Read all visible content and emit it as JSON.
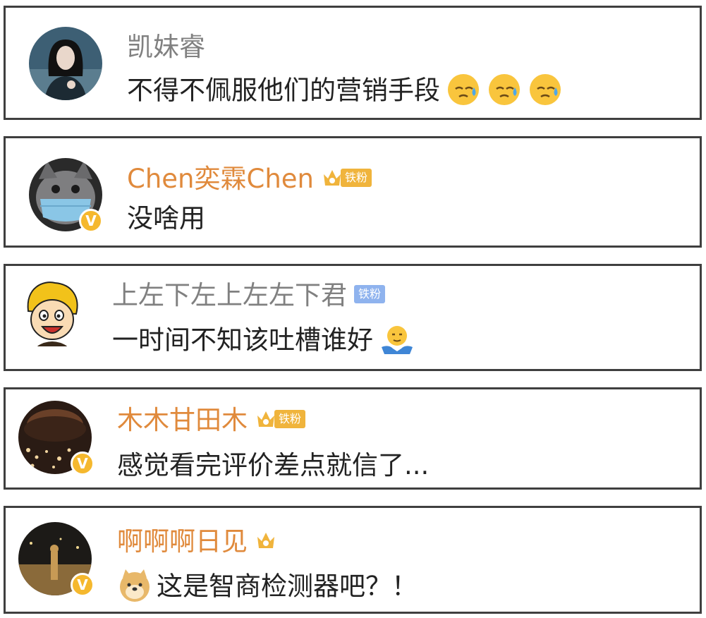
{
  "comments": [
    {
      "user": "凯妹睿",
      "text": "不得不佩服他们的营销手段",
      "name_color": "#808080",
      "verified": false,
      "fan_badge": null,
      "trailing_emojis": [
        "sweat-icon",
        "sweat-icon",
        "sweat-icon"
      ]
    },
    {
      "user": "Chen奕霖Chen",
      "text": "没啥用",
      "name_color": "#e08a3c",
      "verified": true,
      "fan_badge": {
        "crown": true,
        "label": "铁粉",
        "color": "#f0b43c"
      }
    },
    {
      "user": "上左下左上左左下君",
      "text": "一时间不知该吐槽谁好",
      "name_color": "#808080",
      "verified": false,
      "fan_badge": {
        "crown": false,
        "label": "铁粉",
        "color": "#8fb3ee"
      },
      "trailing_emojis": [
        "shrug-icon"
      ]
    },
    {
      "user": "木木甘田木",
      "text": "感觉看完评价差点就信了...",
      "name_color": "#e08a3c",
      "verified": true,
      "fan_badge": {
        "crown": true,
        "label": "铁粉",
        "color": "#f0b43c"
      }
    },
    {
      "user": "啊啊啊日见",
      "text": "这是智商检测器吧？！",
      "name_color": "#e08a3c",
      "verified": true,
      "fan_badge": {
        "crown": true,
        "label": null,
        "color": "#f0b43c"
      },
      "leading_emojis": [
        "doge-icon"
      ]
    }
  ],
  "verified_mark": "V"
}
